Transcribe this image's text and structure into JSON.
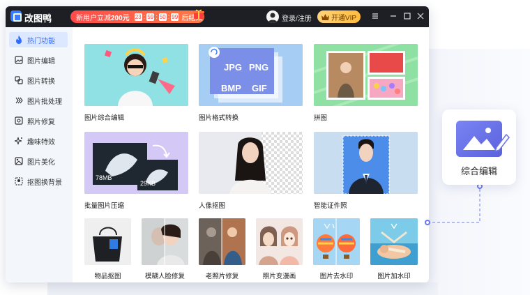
{
  "app": {
    "title": "改图鸭"
  },
  "promo": {
    "text_prefix": "新用户立减",
    "amount": "200元",
    "countdown": [
      "23",
      "59",
      "50",
      "99"
    ],
    "suffix": "后结束"
  },
  "account": {
    "login_label": "登录/注册",
    "vip_label": "开通VIP"
  },
  "sidebar": {
    "items": [
      {
        "label": "热门功能",
        "icon": "flame-icon",
        "active": true
      },
      {
        "label": "图片编辑",
        "icon": "image-edit-icon",
        "active": false
      },
      {
        "label": "图片转换",
        "icon": "convert-icon",
        "active": false
      },
      {
        "label": "图片批处理",
        "icon": "batch-icon",
        "active": false
      },
      {
        "label": "照片修复",
        "icon": "repair-icon",
        "active": false
      },
      {
        "label": "趣味特效",
        "icon": "sparkle-icon",
        "active": false
      },
      {
        "label": "图片美化",
        "icon": "beautify-icon",
        "active": false
      },
      {
        "label": "抠图换背景",
        "icon": "cutout-icon",
        "active": false
      }
    ]
  },
  "features": {
    "large": [
      {
        "label": "图片综合编辑"
      },
      {
        "label": "图片格式转换",
        "formats": [
          "JPG",
          "PNG",
          "BMP",
          "GIF"
        ]
      },
      {
        "label": "拼图"
      },
      {
        "label": "批量图片压缩",
        "size_before": "78MB",
        "size_after": "29KB"
      },
      {
        "label": "人像抠图"
      },
      {
        "label": "智能证件照"
      }
    ],
    "small": [
      {
        "label": "物品抠图"
      },
      {
        "label": "模糊人脸修复"
      },
      {
        "label": "老照片修复"
      },
      {
        "label": "照片变漫画"
      },
      {
        "label": "图片去水印"
      },
      {
        "label": "图片加水印"
      }
    ]
  },
  "floating": {
    "label": "综合编辑"
  },
  "colors": {
    "accent": "#2e6bff",
    "titlebar": "#1e1f24",
    "vip": "#ffc24a",
    "promo": "#ff5a45"
  }
}
